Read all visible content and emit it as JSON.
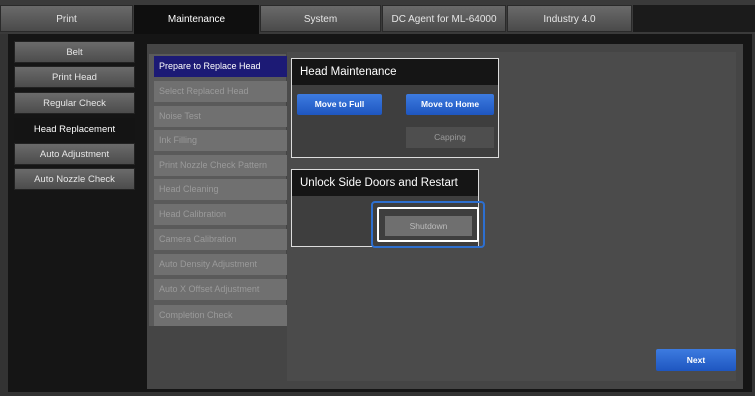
{
  "tabs": [
    {
      "label": "Print"
    },
    {
      "label": "Maintenance"
    },
    {
      "label": "System"
    },
    {
      "label": "DC Agent for ML-64000"
    },
    {
      "label": "Industry 4.0"
    }
  ],
  "sidebar": {
    "items": [
      {
        "label": "Belt"
      },
      {
        "label": "Print Head"
      },
      {
        "label": "Regular Check"
      },
      {
        "label": "Head Replacement"
      },
      {
        "label": "Auto Adjustment"
      },
      {
        "label": "Auto Nozzle Check"
      }
    ]
  },
  "steps": [
    {
      "label": "Prepare to Replace Head"
    },
    {
      "label": "Select Replaced Head"
    },
    {
      "label": "Noise Test"
    },
    {
      "label": "Ink Filling"
    },
    {
      "label": "Print Nozzle Check Pattern"
    },
    {
      "label": "Head Cleaning"
    },
    {
      "label": "Head Calibration"
    },
    {
      "label": "Camera Calibration"
    },
    {
      "label": "Auto Density Adjustment"
    },
    {
      "label": "Auto X Offset Adjustment"
    },
    {
      "label": "Completion Check"
    }
  ],
  "head_maintenance": {
    "title": "Head Maintenance",
    "move_to_full": "Move to Full",
    "move_to_home": "Move to Home",
    "capping": "Capping"
  },
  "unlock": {
    "title": "Unlock Side Doors and Restart",
    "shutdown": "Shutdown"
  },
  "footer": {
    "next": "Next"
  },
  "colors": {
    "active_step": "#1c1a75",
    "primary_button": "#2a66d0",
    "highlight": "#2d6fd0"
  }
}
